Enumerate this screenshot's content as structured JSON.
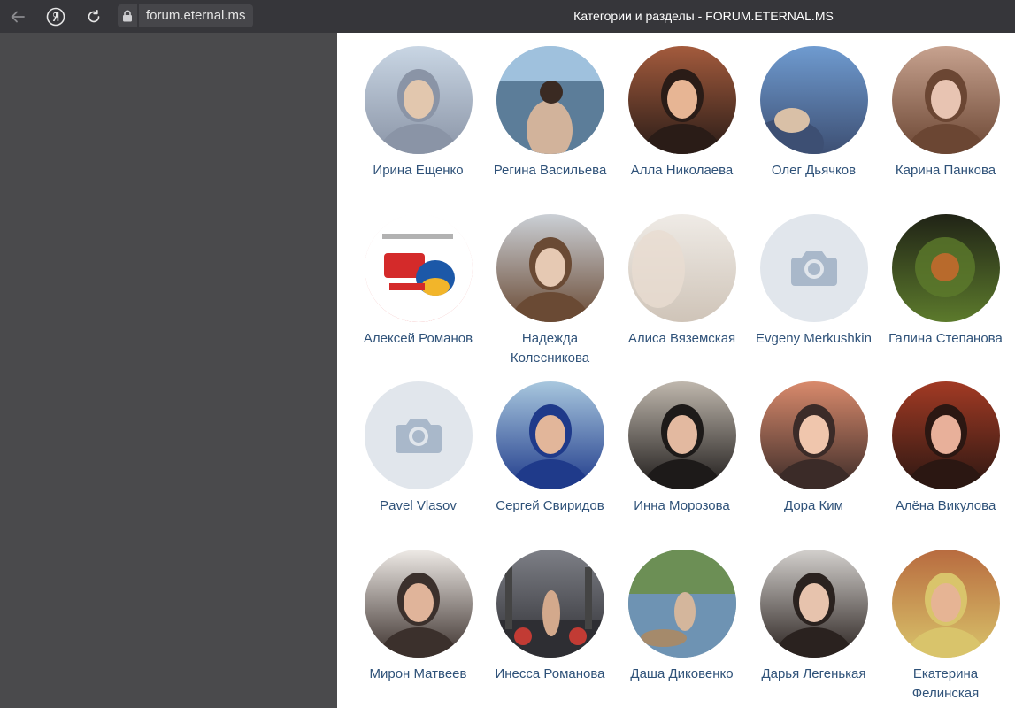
{
  "browser": {
    "url": "forum.eternal.ms",
    "title": "Категории и разделы - FORUM.ETERNAL.MS",
    "icons": [
      "back-arrow-icon",
      "yandex-logo-icon",
      "reload-icon",
      "lock-icon"
    ]
  },
  "people": [
    {
      "name": "Ирина Ещенко",
      "photo": "photo-portrait",
      "colors": [
        "#c9d6e4",
        "#8a94a6",
        "#e2c7ae"
      ]
    },
    {
      "name": "Регина Васильева",
      "photo": "photo-beach",
      "colors": [
        "#9fc1dd",
        "#5c7d99",
        "#d2b39b"
      ]
    },
    {
      "name": "Алла Николаева",
      "photo": "photo-portrait",
      "colors": [
        "#a45b3d",
        "#2a1c17",
        "#e7b594"
      ]
    },
    {
      "name": "Олег Дьячков",
      "photo": "photo-sky",
      "colors": [
        "#6f9bd0",
        "#3d4f73",
        "#d9c0a7"
      ]
    },
    {
      "name": "Карина Панкова",
      "photo": "photo-portrait",
      "colors": [
        "#c7a28f",
        "#6b4633",
        "#e8c4b2"
      ]
    },
    {
      "name": "Алексей Романов",
      "photo": "photo-cartoon",
      "colors": [
        "#ffffff",
        "#d42a2a",
        "#1c58a8"
      ]
    },
    {
      "name": "Надежда Колесникова",
      "photo": "photo-portrait",
      "colors": [
        "#cbd0d6",
        "#6a4a34",
        "#e6c9b3"
      ]
    },
    {
      "name": "Алиса Вяземская",
      "photo": "photo-soft",
      "colors": [
        "#efebe6",
        "#cfc4b8",
        "#e9dcd1"
      ]
    },
    {
      "name": "Evgeny Merkushkin",
      "photo": "camera-placeholder",
      "colors": [
        "#e1e6ec",
        "#a9b8ca"
      ]
    },
    {
      "name": "Галина Степанова",
      "photo": "photo-dark",
      "colors": [
        "#202316",
        "#5c7a2c",
        "#b86a2c"
      ]
    },
    {
      "name": "Pavel Vlasov",
      "photo": "camera-placeholder",
      "colors": [
        "#e1e6ec",
        "#a9b8ca"
      ]
    },
    {
      "name": "Сергей Свиридов",
      "photo": "photo-portrait",
      "colors": [
        "#a8c7de",
        "#1f3a8a",
        "#e2b69a"
      ]
    },
    {
      "name": "Инна Морозова",
      "photo": "photo-portrait",
      "colors": [
        "#bfb7ad",
        "#1d1a19",
        "#e3b9a0"
      ]
    },
    {
      "name": "Дора Ким",
      "photo": "photo-portrait",
      "colors": [
        "#d98a6c",
        "#3b2b28",
        "#f0c6ad"
      ]
    },
    {
      "name": "Алёна Викулова",
      "photo": "photo-portrait",
      "colors": [
        "#a23a24",
        "#2b1712",
        "#e8b09a"
      ]
    },
    {
      "name": "Мирон Матвеев",
      "photo": "photo-portrait",
      "colors": [
        "#eeeae6",
        "#3b302c",
        "#e0b49a"
      ]
    },
    {
      "name": "Инесса Романова",
      "photo": "photo-gym",
      "colors": [
        "#7d7f86",
        "#2e2e33",
        "#c23b34"
      ]
    },
    {
      "name": "Даша Диковенко",
      "photo": "photo-lake",
      "colors": [
        "#6c8f55",
        "#6e93b3",
        "#d4b69c"
      ]
    },
    {
      "name": "Дарья Легенькая",
      "photo": "photo-portrait",
      "colors": [
        "#d3d0cd",
        "#2a221f",
        "#e7c3ad"
      ]
    },
    {
      "name": "Екатерина Фелинская",
      "photo": "photo-portrait",
      "colors": [
        "#b86b3f",
        "#d9c46b",
        "#e6b494"
      ]
    }
  ]
}
